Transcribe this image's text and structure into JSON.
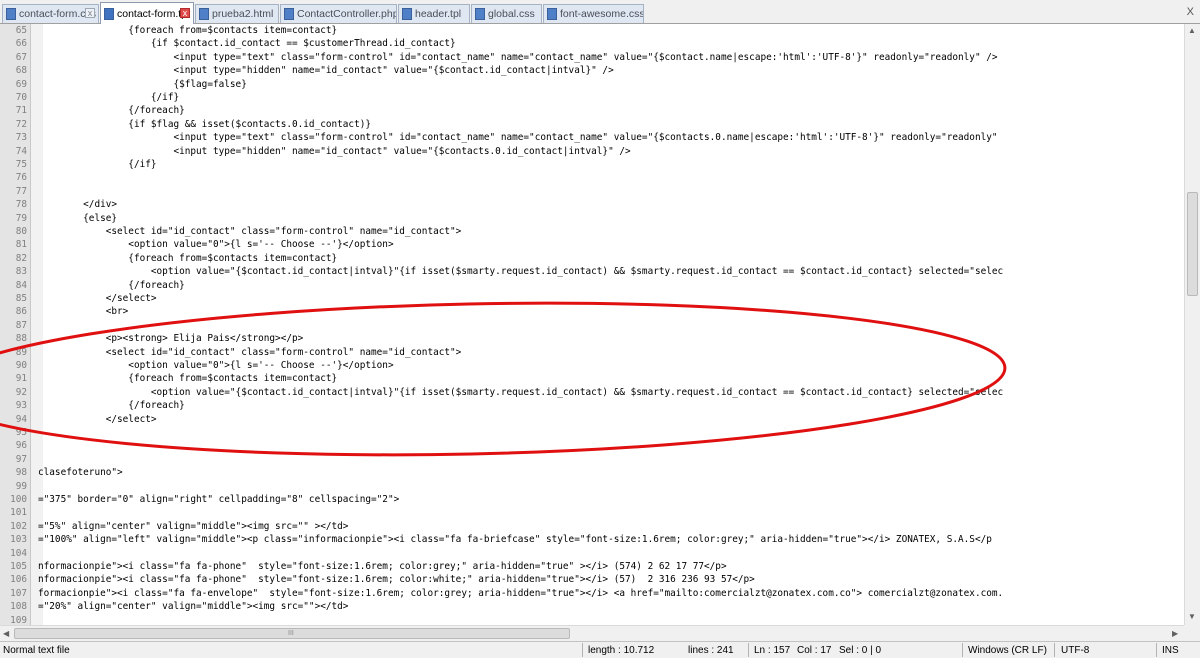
{
  "tabs": [
    {
      "label": "contact-form.css",
      "active": false
    },
    {
      "label": "contact-form.tpl",
      "active": true
    },
    {
      "label": "prueba2.html",
      "active": false
    },
    {
      "label": "ContactController.php",
      "active": false
    },
    {
      "label": "header.tpl",
      "active": false
    },
    {
      "label": "global.css",
      "active": false
    },
    {
      "label": "font-awesome.css",
      "active": false
    }
  ],
  "tab_close_glyph": "x",
  "tab_close_all_glyph": "X",
  "editor": {
    "lines": [
      {
        "n": "65",
        "text": "                {foreach from=$contacts item=contact}"
      },
      {
        "n": "66",
        "text": "                    {if $contact.id_contact == $customerThread.id_contact}"
      },
      {
        "n": "67",
        "text": "                        <input type=\"text\" class=\"form-control\" id=\"contact_name\" name=\"contact_name\" value=\"{$contact.name|escape:'html':'UTF-8'}\" readonly=\"readonly\" />"
      },
      {
        "n": "68",
        "text": "                        <input type=\"hidden\" name=\"id_contact\" value=\"{$contact.id_contact|intval}\" />"
      },
      {
        "n": "69",
        "text": "                        {$flag=false}"
      },
      {
        "n": "70",
        "text": "                    {/if}"
      },
      {
        "n": "71",
        "text": "                {/foreach}"
      },
      {
        "n": "72",
        "text": "                {if $flag && isset($contacts.0.id_contact)}"
      },
      {
        "n": "73",
        "text": "                        <input type=\"text\" class=\"form-control\" id=\"contact_name\" name=\"contact_name\" value=\"{$contacts.0.name|escape:'html':'UTF-8'}\" readonly=\"readonly\""
      },
      {
        "n": "74",
        "text": "                        <input type=\"hidden\" name=\"id_contact\" value=\"{$contacts.0.id_contact|intval}\" />"
      },
      {
        "n": "75",
        "text": "                {/if}"
      },
      {
        "n": "76",
        "text": ""
      },
      {
        "n": "77",
        "text": ""
      },
      {
        "n": "78",
        "text": "        </div>"
      },
      {
        "n": "79",
        "text": "        {else}"
      },
      {
        "n": "80",
        "text": "            <select id=\"id_contact\" class=\"form-control\" name=\"id_contact\">"
      },
      {
        "n": "81",
        "text": "                <option value=\"0\">{l s='-- Choose --'}</option>"
      },
      {
        "n": "82",
        "text": "                {foreach from=$contacts item=contact}"
      },
      {
        "n": "83",
        "text": "                    <option value=\"{$contact.id_contact|intval}\"{if isset($smarty.request.id_contact) && $smarty.request.id_contact == $contact.id_contact} selected=\"selec"
      },
      {
        "n": "84",
        "text": "                {/foreach}"
      },
      {
        "n": "85",
        "text": "            </select>"
      },
      {
        "n": "86",
        "text": "            <br>"
      },
      {
        "n": "87",
        "text": ""
      },
      {
        "n": "88",
        "text": "            <p><strong> Elija Pais</strong></p>"
      },
      {
        "n": "89",
        "text": "            <select id=\"id_contact\" class=\"form-control\" name=\"id_contact\">"
      },
      {
        "n": "90",
        "text": "                <option value=\"0\">{l s='-- Choose --'}</option>"
      },
      {
        "n": "91",
        "text": "                {foreach from=$contacts item=contact}"
      },
      {
        "n": "92",
        "text": "                    <option value=\"{$contact.id_contact|intval}\"{if isset($smarty.request.id_contact) && $smarty.request.id_contact == $contact.id_contact} selected=\"selec"
      },
      {
        "n": "93",
        "text": "                {/foreach}"
      },
      {
        "n": "94",
        "text": "            </select>"
      },
      {
        "n": "95",
        "text": ""
      },
      {
        "n": "96",
        "text": ""
      },
      {
        "n": "97",
        "text": ""
      },
      {
        "n": "98",
        "text": "clasefoteruno\">"
      },
      {
        "n": "99",
        "text": ""
      },
      {
        "n": "100",
        "text": "=\"375\" border=\"0\" align=\"right\" cellpadding=\"8\" cellspacing=\"2\">"
      },
      {
        "n": "101",
        "text": ""
      },
      {
        "n": "102",
        "text": "=\"5%\" align=\"center\" valign=\"middle\"><img src=\"\" ></td>"
      },
      {
        "n": "103",
        "text": "=\"100%\" align=\"left\" valign=\"middle\"><p class=\"informacionpie\"><i class=\"fa fa-briefcase\" style=\"font-size:1.6rem; color:grey;\" aria-hidden=\"true\"></i> ZONATEX, S.A.S</p"
      },
      {
        "n": "104",
        "text": ""
      },
      {
        "n": "105",
        "text": "nformacionpie\"><i class=\"fa fa-phone\"  style=\"font-size:1.6rem; color:grey;\" aria-hidden=\"true\" ></i> (574) 2 62 17 77</p>"
      },
      {
        "n": "106",
        "text": "nformacionpie\"><i class=\"fa fa-phone\"  style=\"font-size:1.6rem; color:white;\" aria-hidden=\"true\"></i> (57)  2 316 236 93 57</p>"
      },
      {
        "n": "107",
        "text": "formacionpie\"><i class=\"fa fa-envelope\"  style=\"font-size:1.6rem; color:grey; aria-hidden=\"true\"></i> <a href=\"mailto:comercialzt@zonatex.com.co\"> comercialzt@zonatex.com."
      },
      {
        "n": "108",
        "text": "=\"20%\" align=\"center\" valign=\"middle\"><img src=\"\"></td>"
      },
      {
        "n": "109",
        "text": ""
      }
    ]
  },
  "annotation": {
    "color": "#e01010"
  },
  "scroll_glyphs": {
    "up": "▲",
    "down": "▼",
    "left": "◀",
    "right": "▶",
    "grip": "III"
  },
  "statusbar": {
    "file_type": "Normal text file",
    "length": "length : 10.712",
    "lines": "lines : 241",
    "ln": "Ln : 157",
    "col": "Col : 17",
    "sel": "Sel : 0 | 0",
    "eol": "Windows (CR LF)",
    "encoding": "UTF-8",
    "mode": "INS"
  }
}
